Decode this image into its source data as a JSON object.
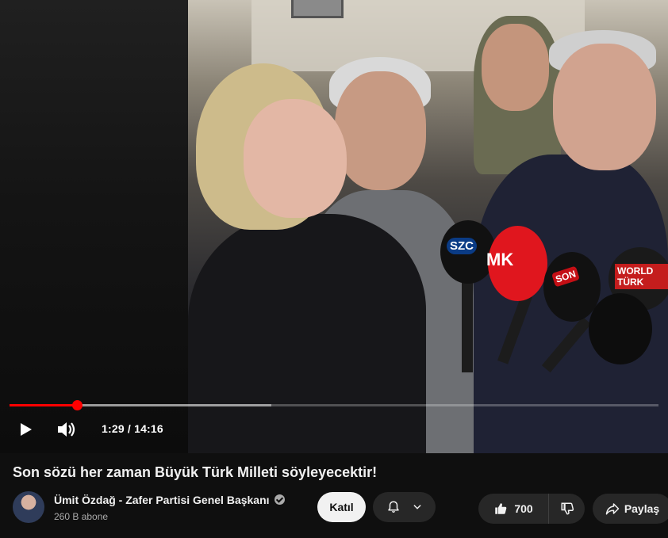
{
  "player": {
    "time_current": "1:29",
    "time_total": "14:16",
    "time_display": "1:29 / 14:16",
    "progress_fraction": 0.104,
    "buffered_fraction": 0.404,
    "progress_color": "#ff0000",
    "mic_labels": {
      "szc": "SZC",
      "mk": "MK",
      "son": "SON",
      "world": "WORLD TÜRK"
    }
  },
  "video": {
    "title": "Son sözü her zaman Büyük Türk Milleti söyleyecektir!"
  },
  "channel": {
    "name": "Ümit Özdağ - Zafer Partisi Genel Başkanı",
    "subscribers": "260 B abone",
    "verified": true
  },
  "actions": {
    "join_label": "Katıl",
    "like_count": "700",
    "share_label": "Paylaş"
  },
  "icons": {
    "play": "play-icon",
    "volume": "volume-icon",
    "bell": "bell-icon",
    "chevron": "chevron-down-icon",
    "like": "thumbs-up-icon",
    "dislike": "thumbs-down-icon",
    "share": "share-icon"
  },
  "colors": {
    "background": "#0f0f0f",
    "button_dark": "#272727",
    "button_light": "#f1f1f1",
    "secondary_text": "#aaaaaa"
  }
}
